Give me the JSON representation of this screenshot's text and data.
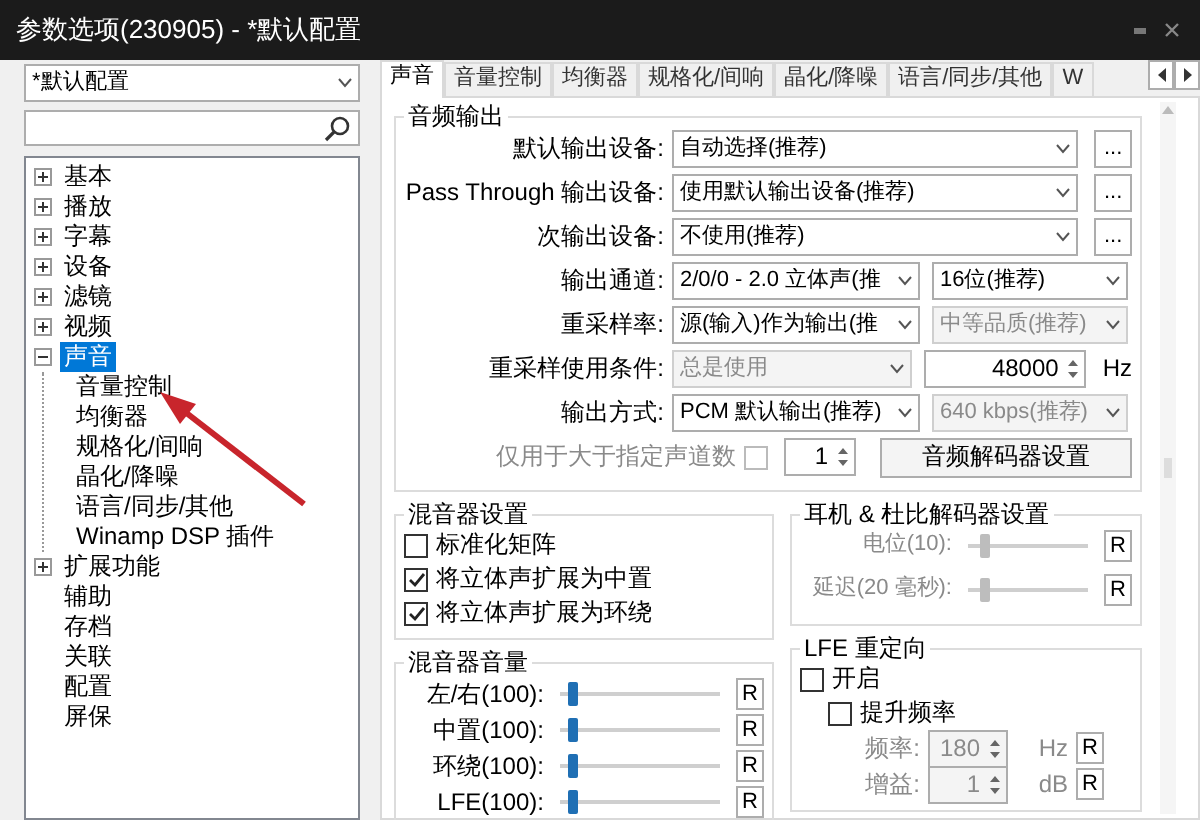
{
  "window": {
    "title": "参数选项(230905) - *默认配置"
  },
  "profile": {
    "value": "*默认配置"
  },
  "tree": [
    {
      "label": "基本",
      "expanded": false,
      "selected": false
    },
    {
      "label": "播放",
      "expanded": false,
      "selected": false
    },
    {
      "label": "字幕",
      "expanded": false,
      "selected": false
    },
    {
      "label": "设备",
      "expanded": false,
      "selected": false
    },
    {
      "label": "滤镜",
      "expanded": false,
      "selected": false
    },
    {
      "label": "视频",
      "expanded": false,
      "selected": false
    },
    {
      "label": "声音",
      "expanded": true,
      "selected": true,
      "children": [
        {
          "label": "音量控制",
          "selected": false
        },
        {
          "label": "均衡器",
          "selected": false
        },
        {
          "label": "规格化/间响",
          "selected": false
        },
        {
          "label": "晶化/降噪",
          "selected": false
        },
        {
          "label": "语言/同步/其他",
          "selected": false
        },
        {
          "label": "Winamp DSP 插件",
          "selected": false
        }
      ]
    },
    {
      "label": "扩展功能",
      "expanded": false,
      "selected": false
    },
    {
      "label": "辅助",
      "selected": false
    },
    {
      "label": "存档",
      "selected": false
    },
    {
      "label": "关联",
      "selected": false
    },
    {
      "label": "配置",
      "selected": false
    },
    {
      "label": "屏保",
      "selected": false
    }
  ],
  "tabs": [
    {
      "label": "声音",
      "selected": true
    },
    {
      "label": "音量控制",
      "selected": false
    },
    {
      "label": "均衡器",
      "selected": false
    },
    {
      "label": "规格化/间响",
      "selected": false
    },
    {
      "label": "晶化/降噪",
      "selected": false
    },
    {
      "label": "语言/同步/其他",
      "selected": false
    },
    {
      "label": "W",
      "selected": false
    }
  ],
  "audio_output": {
    "title": "音频输出",
    "rows": [
      {
        "kind": "device",
        "label": "默认输出设备:",
        "value": "自动选择(推荐)",
        "disabled": false,
        "button": "..."
      },
      {
        "kind": "device",
        "label": "Pass Through 输出设备:",
        "value": "使用默认输出设备(推荐)",
        "disabled": false,
        "button": "..."
      },
      {
        "kind": "device",
        "label": "次输出设备:",
        "value": "不使用(推荐)",
        "disabled": false,
        "button": "..."
      },
      {
        "kind": "pair",
        "label": "输出通道:",
        "value": "2/0/0 - 2.0 立体声(推",
        "disabled": false,
        "second": {
          "value": "16位(推荐)",
          "disabled": false
        }
      },
      {
        "kind": "pair",
        "label": "重采样率:",
        "value": "源(输入)作为输出(推",
        "disabled": false,
        "second": {
          "value": "中等品质(推荐)",
          "disabled": true
        }
      },
      {
        "kind": "spin",
        "label": "重采样使用条件:",
        "value": "总是使用",
        "disabled": true,
        "second": {
          "value": "48000",
          "unit": "Hz",
          "disabled": false
        }
      },
      {
        "kind": "pair",
        "label": "输出方式:",
        "value": "PCM 默认输出(推荐)",
        "disabled": false,
        "second": {
          "value": "640 kbps(推荐)",
          "disabled": true
        }
      },
      {
        "kind": "limit",
        "label": "仅用于大于指定声道数",
        "disabled": true,
        "checked": false,
        "value": "1",
        "button": "音频解码器设置"
      }
    ]
  },
  "mixer_settings": {
    "title": "混音器设置",
    "options": [
      {
        "label": "标准化矩阵",
        "checked": false
      },
      {
        "label": "将立体声扩展为中置",
        "checked": true
      },
      {
        "label": "将立体声扩展为环绕",
        "checked": true
      }
    ]
  },
  "headphone": {
    "title": "耳机 & 杜比解码器设置",
    "rows": [
      {
        "label": "电位(10):",
        "level": 0.1,
        "disabled": true,
        "button": "R"
      },
      {
        "label": "延迟(20 毫秒):",
        "level": 0.1,
        "disabled": true,
        "button": "R"
      }
    ]
  },
  "mixer_volume": {
    "title": "混音器音量",
    "rows": [
      {
        "label": "左/右(100):",
        "level": 0.05,
        "button": "R"
      },
      {
        "label": "中置(100):",
        "level": 0.05,
        "button": "R"
      },
      {
        "label": "环绕(100):",
        "level": 0.05,
        "button": "R"
      },
      {
        "label": "LFE(100):",
        "level": 0.05,
        "button": "R"
      }
    ]
  },
  "lfe": {
    "title": "LFE 重定向",
    "options": [
      {
        "label": "开启",
        "checked": false,
        "children": [
          {
            "label": "提升频率",
            "checked": false
          }
        ]
      }
    ],
    "rows": [
      {
        "label": "频率:",
        "value": "180",
        "unit": "Hz",
        "button": "R",
        "disabled": true
      },
      {
        "label": "增益:",
        "value": "1",
        "unit": "dB",
        "button": "R",
        "disabled": true
      }
    ]
  }
}
